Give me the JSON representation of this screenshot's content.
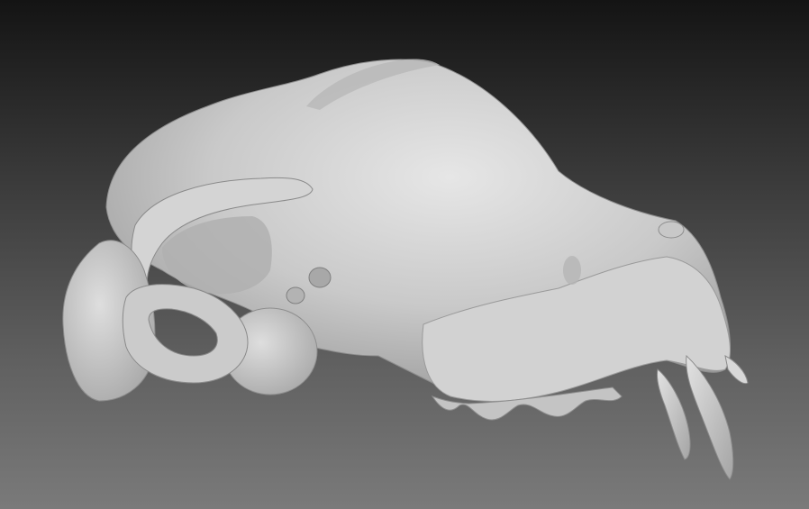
{
  "viewer": {
    "background_top": "#141414",
    "background_bottom": "#7a7a7a",
    "model": {
      "subject": "skull-mesh",
      "surface_color": "#cfcfcf"
    }
  }
}
